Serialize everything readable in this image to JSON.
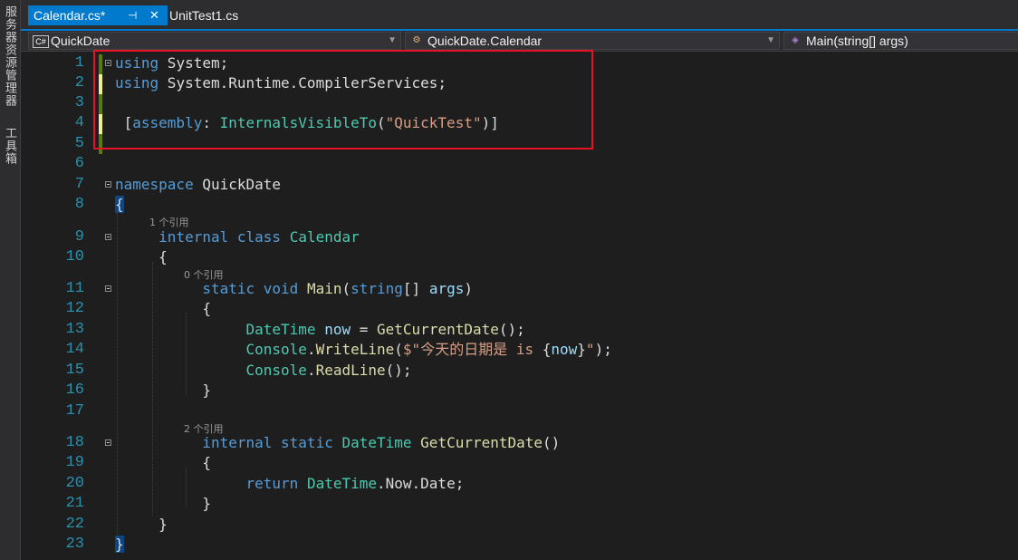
{
  "side_panel": {
    "server_explorer": "服务器资源管理器",
    "toolbox": "工具箱"
  },
  "tabs": [
    {
      "label": "Calendar.cs*",
      "active": true,
      "pin_icon": "pin-icon",
      "close_icon": "close-icon"
    },
    {
      "label": "UnitTest1.cs",
      "active": false
    }
  ],
  "navbar": {
    "project": {
      "badge": "C#",
      "label": "QuickDate"
    },
    "type": {
      "label": "QuickDate.Calendar",
      "icon": "class-icon"
    },
    "member": {
      "label": "Main(string[] args)",
      "icon": "method-icon"
    }
  },
  "code_lens": {
    "line9": "1 个引用",
    "line11": "0 个引用",
    "line18": "2 个引用"
  },
  "code_lines": [
    {
      "n": "1",
      "text": "using System;"
    },
    {
      "n": "2",
      "text": "using System.Runtime.CompilerServices;"
    },
    {
      "n": "3",
      "text": ""
    },
    {
      "n": "4",
      "text": "[assembly: InternalsVisibleTo(\"QuickTest\")]"
    },
    {
      "n": "5",
      "text": ""
    },
    {
      "n": "6",
      "text": ""
    },
    {
      "n": "7",
      "text": "namespace QuickDate"
    },
    {
      "n": "8",
      "text": "{"
    },
    {
      "n": "9",
      "text": "    internal class Calendar"
    },
    {
      "n": "10",
      "text": "    {"
    },
    {
      "n": "11",
      "text": "        static void Main(string[] args)"
    },
    {
      "n": "12",
      "text": "        {"
    },
    {
      "n": "13",
      "text": "            DateTime now = GetCurrentDate();"
    },
    {
      "n": "14",
      "text": "            Console.WriteLine($\"今天的日期是 is {now}\");"
    },
    {
      "n": "15",
      "text": "            Console.ReadLine();"
    },
    {
      "n": "16",
      "text": "        }"
    },
    {
      "n": "17",
      "text": ""
    },
    {
      "n": "18",
      "text": "        internal static DateTime GetCurrentDate()"
    },
    {
      "n": "19",
      "text": "        {"
    },
    {
      "n": "20",
      "text": "            return DateTime.Now.Date;"
    },
    {
      "n": "21",
      "text": "        }"
    },
    {
      "n": "22",
      "text": "    }"
    },
    {
      "n": "23",
      "text": "}"
    }
  ],
  "colors": {
    "keyword": "#569cd6",
    "type": "#4ec9b0",
    "method": "#dcdcaa",
    "string": "#d69d85",
    "variable": "#9cdcfe",
    "accent": "#007acc",
    "highlight_box": "#e81123"
  }
}
